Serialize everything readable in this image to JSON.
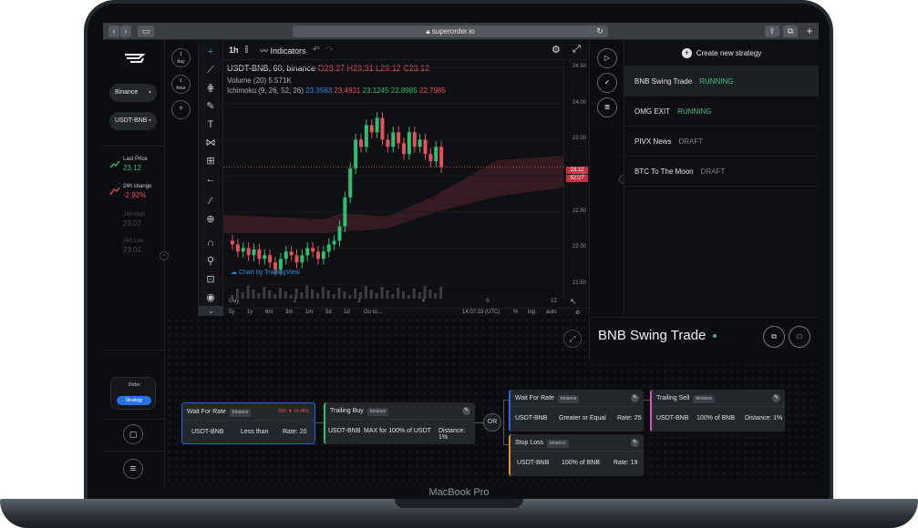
{
  "device": {
    "label": "MacBook Pro"
  },
  "browser": {
    "url": "superorder.io"
  },
  "sidebar": {
    "exchange": "Binance",
    "pair": "USDT-BNB",
    "last_price_label": "Last Price",
    "last_price": "23.12",
    "change_label": "24h change",
    "change": "-2.92%",
    "high_label": "24h High",
    "high": "23.07",
    "low_label": "24h Low",
    "low": "23.01",
    "order_label": "Order",
    "strategy_label": "Strategy"
  },
  "timeframes": {
    "day_num": "1",
    "day_unit": "day",
    "hour_num": "1",
    "hour_unit": "hour"
  },
  "chart": {
    "interval": "1h",
    "indicators_label": "Indicators",
    "symbol": "USDT-BNB, 60, binance",
    "open": "O23.27",
    "high": "H23.31",
    "low": "L23.12",
    "close": "C23.12",
    "volume_label": "Volume (20)",
    "volume_value": "5.571K",
    "ichimoku_label": "Ichimoku (9, 26, 52, 26)",
    "ichimoku_values": [
      "23.3583",
      "23.4931",
      "23.1245",
      "22.8985",
      "22.7985"
    ],
    "attribution": "Chart by TradingView",
    "price_tag": "23.12",
    "time_tag": "52:27",
    "ranges": [
      "5y",
      "1y",
      "6m",
      "3m",
      "1m",
      "5d",
      "1d",
      "Go to..."
    ],
    "clock": "14:07:33 (UTC)",
    "scale_opts": [
      "%",
      "log",
      "auto"
    ]
  },
  "chart_data": {
    "type": "candlestick",
    "title": "USDT-BNB, 60, binance",
    "x_ticks": [
      "May",
      "2",
      "3",
      "4",
      "5",
      "13"
    ],
    "y_ticks": [
      "24.50",
      "24.00",
      "23.50",
      "23.00",
      "22.50",
      "22.00",
      "21.50"
    ],
    "ylim": [
      21.3,
      24.6
    ],
    "candles_close": [
      22.05,
      21.95,
      22.0,
      21.9,
      21.98,
      21.85,
      21.9,
      21.8,
      21.7,
      21.85,
      21.95,
      21.9,
      21.8,
      21.9,
      22.0,
      21.95,
      21.85,
      21.95,
      22.05,
      22.1,
      22.3,
      22.7,
      23.1,
      23.5,
      23.4,
      23.7,
      23.6,
      23.8,
      23.5,
      23.4,
      23.6,
      23.45,
      23.3,
      23.6,
      23.4,
      23.5,
      23.3,
      23.2,
      23.4,
      23.12
    ]
  },
  "strategies": {
    "create_label": "Create new strategy",
    "items": [
      {
        "name": "BNB Swing Trade",
        "status": "RUNNING"
      },
      {
        "name": "OMG EXIT",
        "status": "RUNNING"
      },
      {
        "name": "PIVX News",
        "status": "DRAFT"
      },
      {
        "name": "BTC To The Moon",
        "status": "DRAFT"
      }
    ]
  },
  "editor": {
    "title": "BNB Swing Trade",
    "or_label": "OR",
    "nodes": [
      {
        "title": "Wait For Rate",
        "exchange": "binance",
        "warn": "Diff: ▼ 14.48%",
        "pair": "USDT-BNB",
        "condition": "Less than",
        "param": "Rate: 20",
        "color": "#2c64e0"
      },
      {
        "title": "Trailing Buy",
        "exchange": "binance",
        "pair": "USDT-BNB",
        "condition": "MAX for 100% of USDT",
        "param": "Distance: 1%",
        "color": "#2fbf71"
      },
      {
        "title": "Wait For Rate",
        "exchange": "binance",
        "pair": "USDT-BNB",
        "condition": "Greater or Equal",
        "param": "Rate: 25",
        "color": "#2c64e0"
      },
      {
        "title": "Stop Loss",
        "exchange": "binance",
        "pair": "USDT-BNB",
        "condition": "100% of BNB",
        "param": "Rate: 19",
        "color": "#e0902c"
      },
      {
        "title": "Trailing Sell",
        "exchange": "binance",
        "pair": "USDT-BNB",
        "condition": "100% of BNB",
        "param": "Distance: 1%",
        "color": "#d257b6"
      }
    ]
  }
}
